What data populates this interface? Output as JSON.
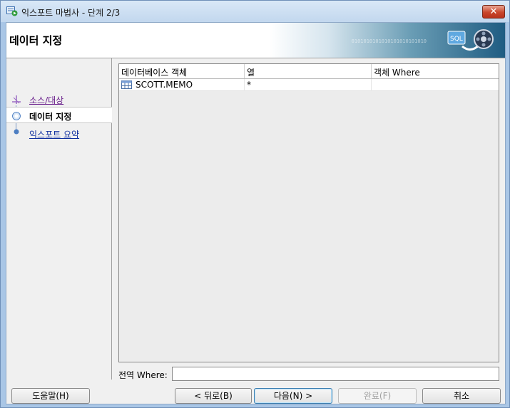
{
  "window": {
    "title": "익스포트 마법사 - 단계 2/3",
    "close_label": "✕"
  },
  "header": {
    "title": "데이터 지정",
    "binary_text": "0101010101010101010101010",
    "binary_text2": "0101010101010",
    "sql_label": "SQL"
  },
  "steps": [
    {
      "label": "소스/대상",
      "state": "done"
    },
    {
      "label": "데이터 지정",
      "state": "active"
    },
    {
      "label": "익스포트 요약",
      "state": "next"
    }
  ],
  "grid": {
    "columns": [
      "데이터베이스 객체",
      "열",
      "객체 Where"
    ],
    "rows": [
      {
        "object": "SCOTT.MEMO",
        "columns": "*",
        "where": ""
      }
    ]
  },
  "global_where": {
    "label": "전역 Where:",
    "value": ""
  },
  "buttons": {
    "help": "도움말(H)",
    "back": "< 뒤로(B)",
    "next": "다음(N) >",
    "finish": "완료(F)",
    "cancel": "취소"
  },
  "colors": {
    "accent": "#1f5c82",
    "done_step": "#6a1f8c",
    "link_step": "#1030a0"
  }
}
